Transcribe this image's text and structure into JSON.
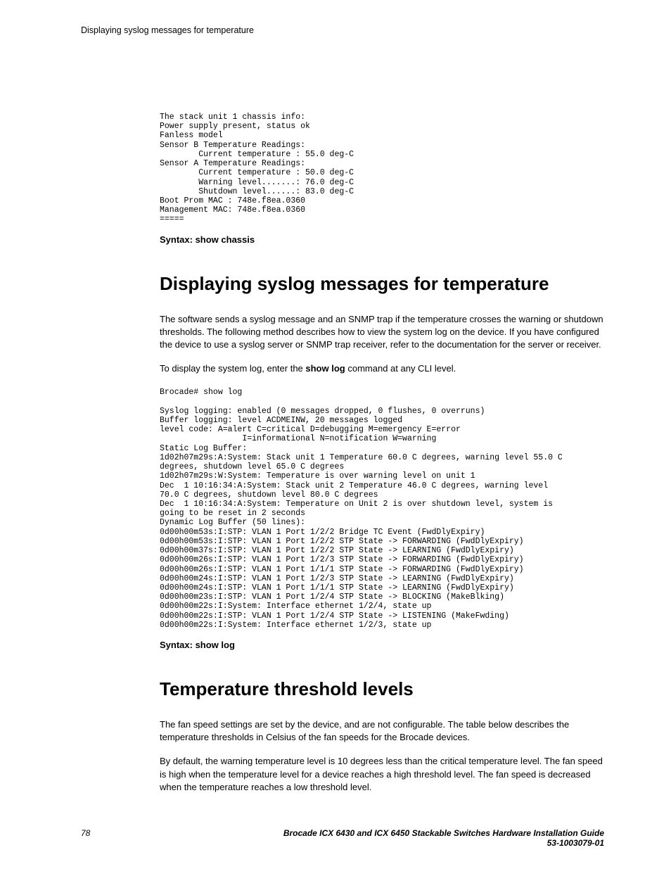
{
  "header": {
    "running_title": "Displaying syslog messages for temperature"
  },
  "code1": "The stack unit 1 chassis info:\nPower supply present, status ok\nFanless model\nSensor B Temperature Readings:\n        Current temperature : 55.0 deg-C\nSensor A Temperature Readings:\n        Current temperature : 50.0 deg-C\n        Warning level.......: 76.0 deg-C\n        Shutdown level......: 83.0 deg-C\nBoot Prom MAC : 748e.f8ea.0360\nManagement MAC: 748e.f8ea.0360\n=====",
  "syntax1": "Syntax: show chassis",
  "section1": {
    "heading": "Displaying syslog messages for temperature",
    "para1": "The software sends a syslog message and an SNMP trap if the temperature crosses the warning or shutdown thresholds. The following method describes how to view the system log on the device. If you have configured the device to use a syslog server or SNMP trap receiver, refer to the documentation for the server or receiver.",
    "para2_pre": "To display the system log, enter the ",
    "para2_bold": "show log",
    "para2_post": " command at any CLI level."
  },
  "code2": "Brocade# show log\n\nSyslog logging: enabled (0 messages dropped, 0 flushes, 0 overruns)\nBuffer logging: level ACDMEINW, 20 messages logged\nlevel code: A=alert C=critical D=debugging M=emergency E=error\n                 I=informational N=notification W=warning\nStatic Log Buffer:\n1d02h07m29s:A:System: Stack unit 1 Temperature 60.0 C degrees, warning level 55.0 C\ndegrees, shutdown level 65.0 C degrees\n1d02h07m29s:W:System: Temperature is over warning level on unit 1\nDec  1 10:16:34:A:System: Stack unit 2 Temperature 46.0 C degrees, warning level\n70.0 C degrees, shutdown level 80.0 C degrees\nDec  1 10:16:34:A:System: Temperature on Unit 2 is over shutdown level, system is\ngoing to be reset in 2 seconds\nDynamic Log Buffer (50 lines):\n0d00h00m53s:I:STP: VLAN 1 Port 1/2/2 Bridge TC Event (FwdDlyExpiry)\n0d00h00m53s:I:STP: VLAN 1 Port 1/2/2 STP State -> FORWARDING (FwdDlyExpiry)\n0d00h00m37s:I:STP: VLAN 1 Port 1/2/2 STP State -> LEARNING (FwdDlyExpiry)\n0d00h00m26s:I:STP: VLAN 1 Port 1/2/3 STP State -> FORWARDING (FwdDlyExpiry)\n0d00h00m26s:I:STP: VLAN 1 Port 1/1/1 STP State -> FORWARDING (FwdDlyExpiry)\n0d00h00m24s:I:STP: VLAN 1 Port 1/2/3 STP State -> LEARNING (FwdDlyExpiry)\n0d00h00m24s:I:STP: VLAN 1 Port 1/1/1 STP State -> LEARNING (FwdDlyExpiry)\n0d00h00m23s:I:STP: VLAN 1 Port 1/2/4 STP State -> BLOCKING (MakeBlking)\n0d00h00m22s:I:System: Interface ethernet 1/2/4, state up\n0d00h00m22s:I:STP: VLAN 1 Port 1/2/4 STP State -> LISTENING (MakeFwding)\n0d00h00m22s:I:System: Interface ethernet 1/2/3, state up",
  "syntax2": "Syntax: show log",
  "section2": {
    "heading": "Temperature threshold levels",
    "para1": "The fan speed settings are set by the device, and are not configurable. The table below describes the temperature thresholds in Celsius of the fan speeds for the Brocade devices.",
    "para2": "By default, the warning temperature level is 10 degrees less than the critical temperature level. The fan speed is high when the temperature level for a device reaches a high threshold level. The fan speed is decreased when the temperature reaches a low threshold level."
  },
  "footer": {
    "page_number": "78",
    "doc_title": "Brocade ICX 6430 and ICX 6450 Stackable Switches Hardware Installation Guide",
    "doc_number": "53-1003079-01"
  }
}
